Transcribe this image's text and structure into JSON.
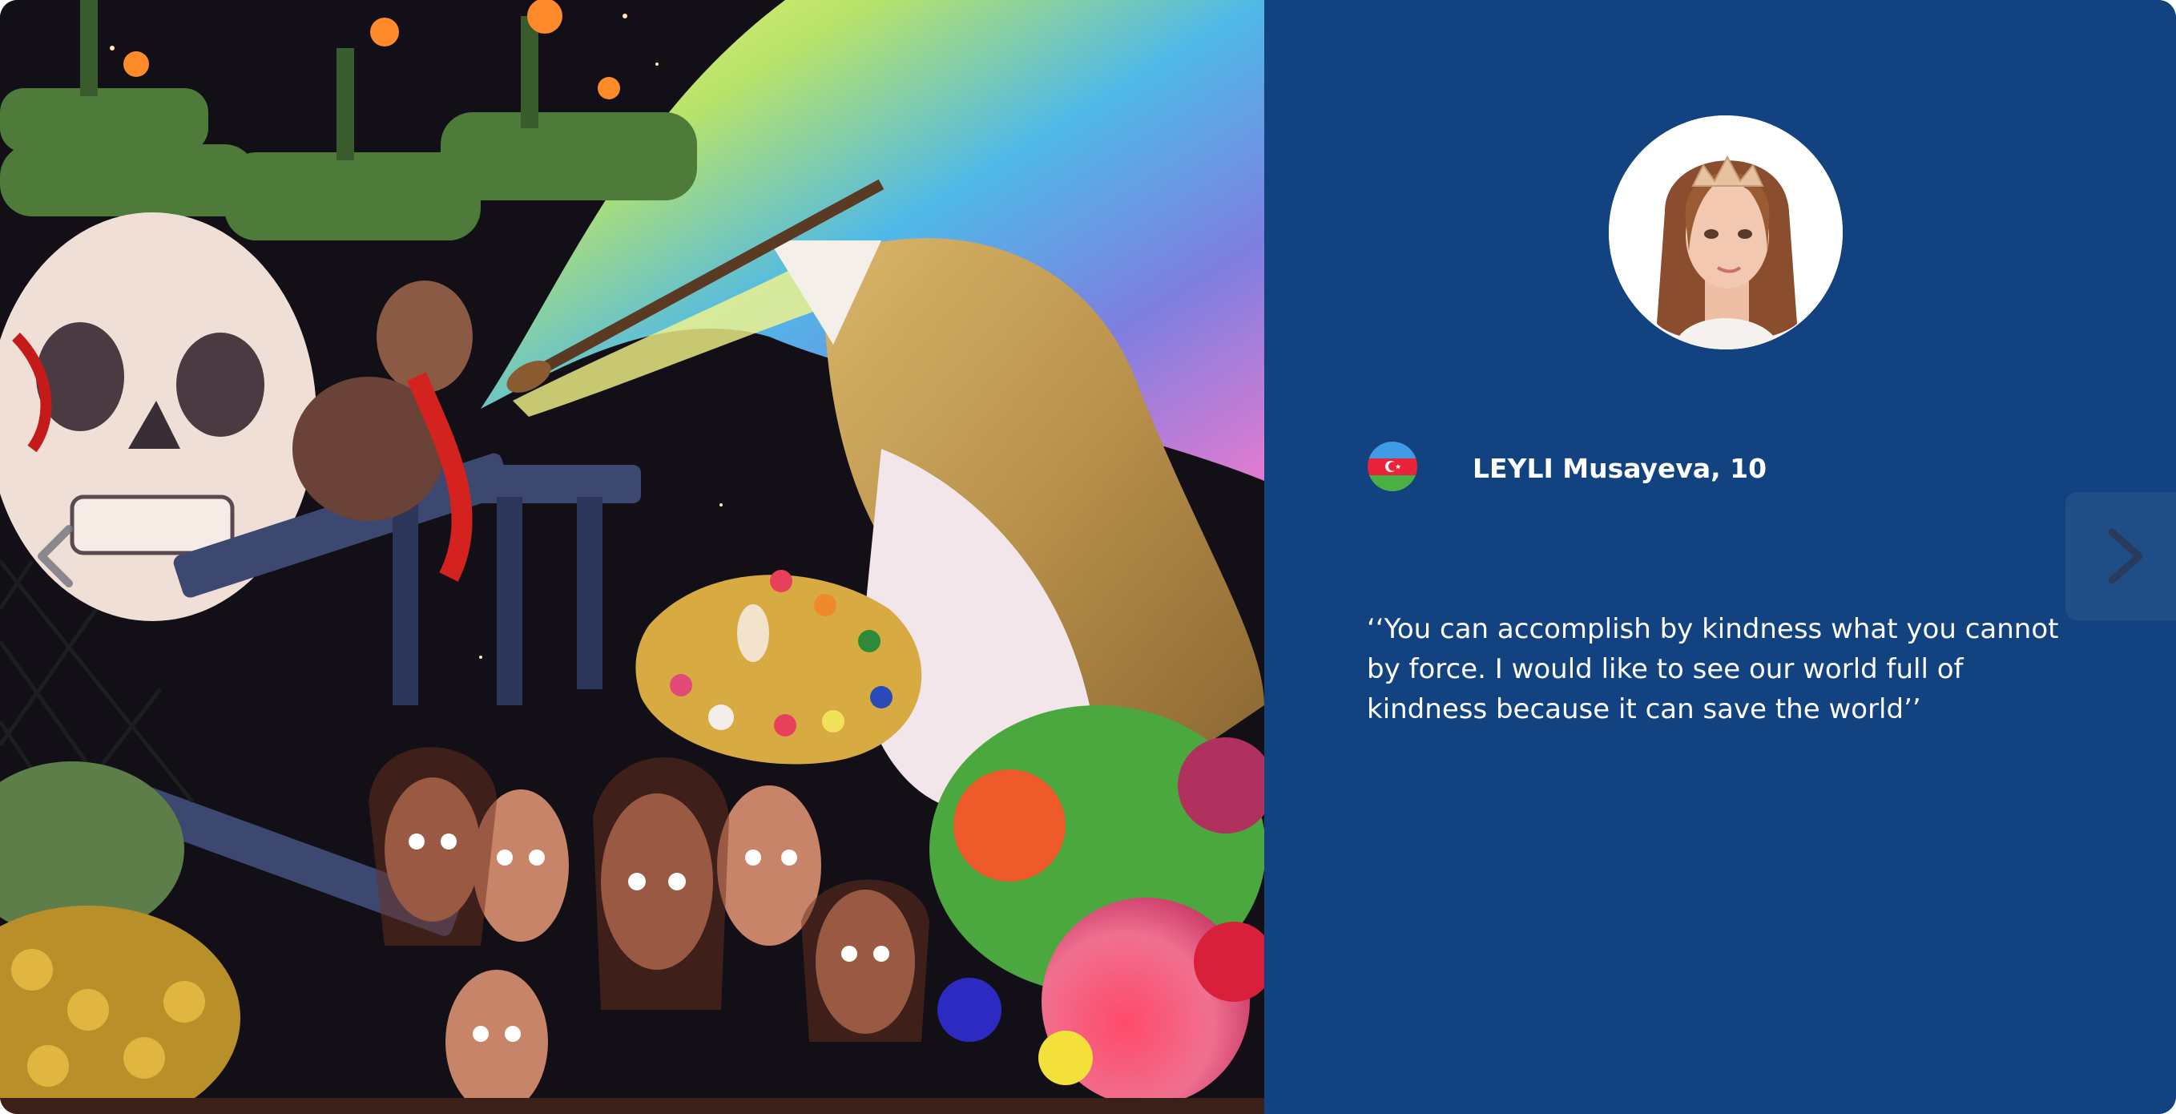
{
  "artwork": {
    "description_icon": "painting-image"
  },
  "artist": {
    "name_age": "LEYLI Musayeva, 10",
    "country_flag_icon": "azerbaijan-flag-icon",
    "avatar_icon": "artist-portrait-photo"
  },
  "quote": {
    "text": "‘‘You can accomplish by kindness what you cannot by force. I would like to see our world full of kindness because it can save the world’’"
  },
  "navigation": {
    "next_icon": "chevron-right-icon",
    "prev_icon": "chevron-left-icon"
  },
  "colors": {
    "panel_background": "#12427f",
    "text": "#ffffff"
  }
}
